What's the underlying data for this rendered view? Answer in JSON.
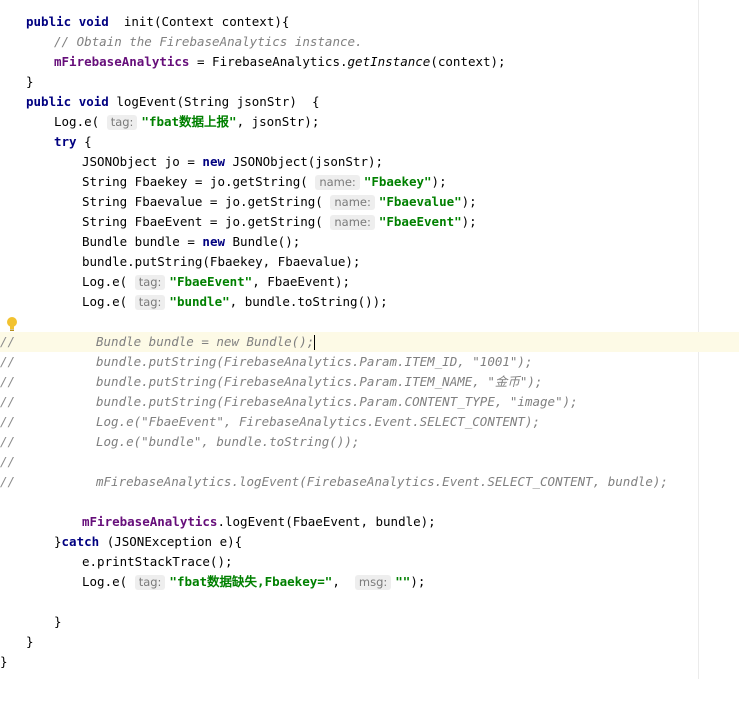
{
  "editor": {
    "l1": {
      "kw1": "public",
      "kw2": "void",
      "rest": "  init(Context context){"
    },
    "l2": {
      "comment": "// Obtain the FirebaseAnalytics instance."
    },
    "l3": {
      "field": "mFirebaseAnalytics",
      "mid": " = FirebaseAnalytics.",
      "method": "getInstance",
      "tail": "(context);"
    },
    "l4": {
      "text": "}"
    },
    "l5": {
      "kw1": "public",
      "kw2": "void",
      "rest": " logEvent(String jsonStr)  {"
    },
    "l6": {
      "pre": "Log.e(",
      "hint": "tag:",
      "str": "\"fbat数据上报\"",
      "tail": ", jsonStr);"
    },
    "l7": {
      "kw": "try",
      "tail": " {"
    },
    "l8": {
      "pre": "JSONObject jo = ",
      "kw": "new",
      "tail": " JSONObject(jsonStr);"
    },
    "l9": {
      "pre": "String Fbaekey = jo.getString(",
      "hint": "name:",
      "str": "\"Fbaekey\"",
      "tail": ");"
    },
    "l10": {
      "pre": "String Fbaevalue = jo.getString(",
      "hint": "name:",
      "str": "\"Fbaevalue\"",
      "tail": ");"
    },
    "l11": {
      "pre": "String FbaeEvent = jo.getString(",
      "hint": "name:",
      "str": "\"FbaeEvent\"",
      "tail": ");"
    },
    "l12": {
      "pre": "Bundle bundle = ",
      "kw": "new",
      "tail": " Bundle();"
    },
    "l13": {
      "text": "bundle.putString(Fbaekey, Fbaevalue);"
    },
    "l14": {
      "pre": "Log.e(",
      "hint": "tag:",
      "str": "\"FbaeEvent\"",
      "tail": ", FbaeEvent);"
    },
    "l15": {
      "pre": "Log.e(",
      "hint": "tag:",
      "str": "\"bundle\"",
      "tail": ", bundle.toString());"
    },
    "c1": {
      "mark": "//",
      "code": "Bundle bundle = new Bundle();"
    },
    "c2": {
      "mark": "//",
      "code": "bundle.putString(FirebaseAnalytics.Param.ITEM_ID, \"1001\");"
    },
    "c3": {
      "mark": "//",
      "code": "bundle.putString(FirebaseAnalytics.Param.ITEM_NAME, \"金币\");"
    },
    "c4": {
      "mark": "//",
      "code": "bundle.putString(FirebaseAnalytics.Param.CONTENT_TYPE, \"image\");"
    },
    "c5": {
      "mark": "//",
      "code": "Log.e(\"FbaeEvent\", FirebaseAnalytics.Event.SELECT_CONTENT);"
    },
    "c6": {
      "mark": "//",
      "code": "Log.e(\"bundle\", bundle.toString());"
    },
    "c7": {
      "mark": "//",
      "code": ""
    },
    "c8": {
      "mark": "//",
      "code": "mFirebaseAnalytics.logEvent(FirebaseAnalytics.Event.SELECT_CONTENT, bundle);"
    },
    "l16": {
      "field": "mFirebaseAnalytics",
      "tail": ".logEvent(FbaeEvent, bundle);"
    },
    "l17": {
      "pre": "}",
      "kw": "catch",
      "tail": " (JSONException e){"
    },
    "l18": {
      "text": "e.printStackTrace();"
    },
    "l19": {
      "pre": "Log.e(",
      "hint": "tag:",
      "str": "\"fbat数据缺失,Fbaekey=\"",
      "mid": ", ",
      "hint2": "msg:",
      "str2": "\"\"",
      "tail": ");"
    },
    "l20": {
      "text": "}"
    },
    "l21": {
      "text": "}"
    },
    "l22": {
      "text": "}"
    }
  }
}
